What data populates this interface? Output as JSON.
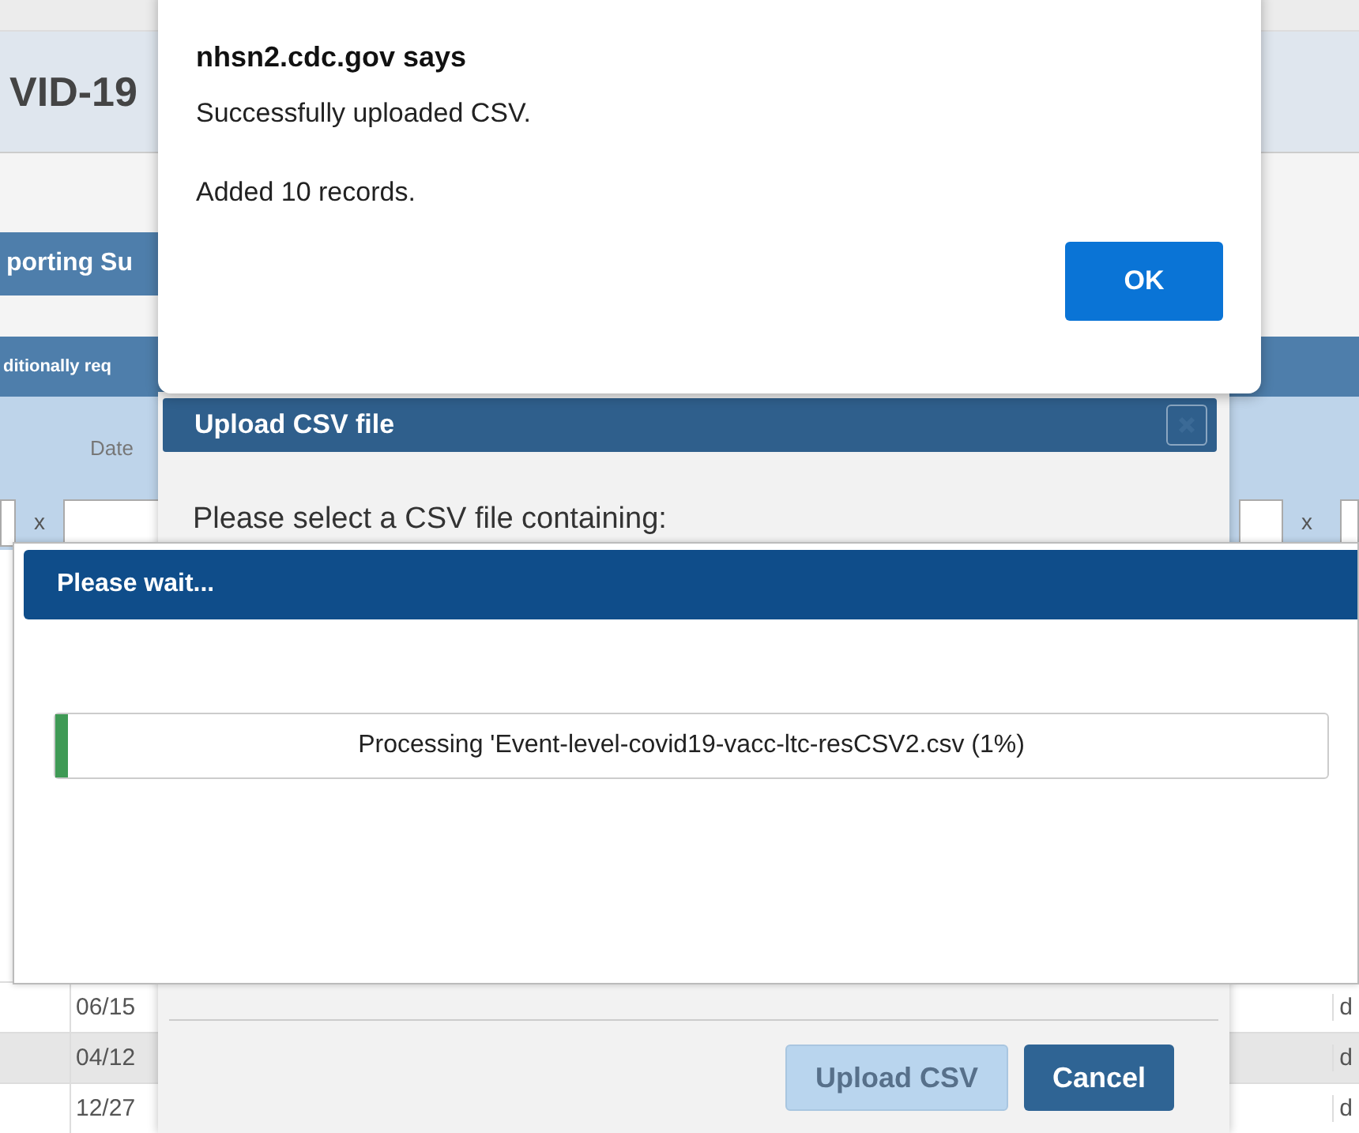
{
  "background_page": {
    "title": "VID-19",
    "section_bar": "porting Su",
    "sub_bar": "ditionally req",
    "table": {
      "column_1": "Date",
      "filter_clear_left": "x",
      "filter_clear_right": "x",
      "rows": [
        {
          "column_1": "06/15",
          "column_2": "d"
        },
        {
          "column_1": "04/12",
          "column_2": "d"
        },
        {
          "column_1": "12/27",
          "column_2": "d"
        }
      ]
    }
  },
  "upload_dialog": {
    "title": "Upload CSV file",
    "instruction": "Please select a CSV file containing:",
    "buttons": [
      {
        "label": "Upload CSV",
        "disabled": true
      },
      {
        "label": "Cancel",
        "disabled": false
      }
    ]
  },
  "progress_dialog": {
    "title": "Please wait...",
    "progress": {
      "level": 0.01,
      "label": "Processing 'Event-level-covid19-vacc-ltc-resCSV2.csv (1%)"
    }
  },
  "alert": {
    "title": "nhsn2.cdc.gov says",
    "messages": [
      "Successfully uploaded CSV.",
      "Added 10 records."
    ],
    "button": "OK"
  }
}
